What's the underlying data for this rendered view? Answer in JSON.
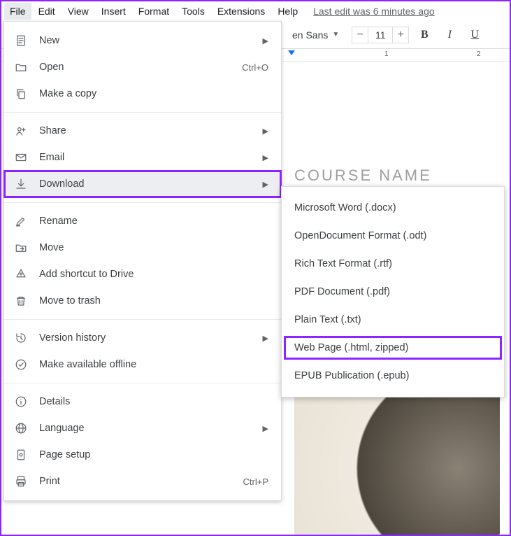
{
  "menubar": {
    "items": [
      "File",
      "Edit",
      "View",
      "Insert",
      "Format",
      "Tools",
      "Extensions",
      "Help"
    ],
    "last_edit": "Last edit was 6 minutes ago"
  },
  "toolbar": {
    "font_name": "en Sans",
    "font_size": "11"
  },
  "ruler": {
    "n1": "1",
    "n2": "2"
  },
  "document": {
    "heading": "COURSE NAME"
  },
  "file_menu": {
    "new": "New",
    "open": "Open",
    "open_shortcut": "Ctrl+O",
    "make_copy": "Make a copy",
    "share": "Share",
    "email": "Email",
    "download": "Download",
    "rename": "Rename",
    "move": "Move",
    "shortcut_drive": "Add shortcut to Drive",
    "trash": "Move to trash",
    "version_history": "Version history",
    "offline": "Make available offline",
    "details": "Details",
    "language": "Language",
    "page_setup": "Page setup",
    "print": "Print",
    "print_shortcut": "Ctrl+P"
  },
  "download_submenu": {
    "items": [
      "Microsoft Word (.docx)",
      "OpenDocument Format (.odt)",
      "Rich Text Format (.rtf)",
      "PDF Document (.pdf)",
      "Plain Text (.txt)",
      "Web Page (.html, zipped)",
      "EPUB Publication (.epub)"
    ]
  }
}
